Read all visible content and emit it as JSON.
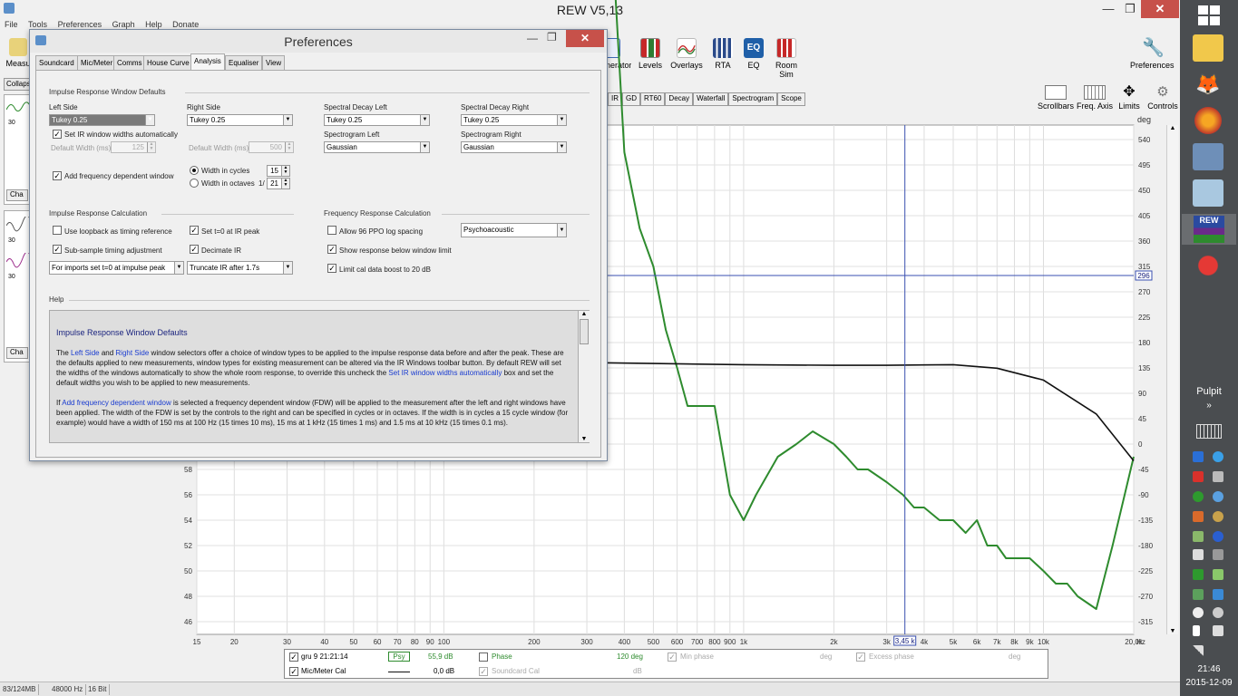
{
  "app": {
    "title": "REW V5,13",
    "minimize": "—",
    "maximize": "❐",
    "close": "✕"
  },
  "menu": [
    "File",
    "Tools",
    "Preferences",
    "Graph",
    "Help",
    "Donate"
  ],
  "toolbar_left": {
    "measure": "Measu",
    "collapse": "Collaps",
    "chart1": "Cha",
    "chart2": "Cha",
    "num30a": "30",
    "num30b": "30",
    "num30c": "30"
  },
  "toolbar": [
    {
      "label": "nerator",
      "icon": "generator-icon"
    },
    {
      "label": "Levels",
      "icon": "levels-icon"
    },
    {
      "label": "Overlays",
      "icon": "overlays-icon"
    },
    {
      "label": "RTA",
      "icon": "rta-icon"
    },
    {
      "label": "EQ",
      "icon": "eq-icon"
    },
    {
      "label": "Room Sim",
      "icon": "room-sim-icon"
    }
  ],
  "preferences_btn": "Preferences",
  "graph_tabs": [
    "IR",
    "GD",
    "RT60",
    "Decay",
    "Waterfall",
    "Spectrogram",
    "Scope"
  ],
  "graph_controls": [
    "Scrollbars",
    "Freq. Axis",
    "Limits",
    "Controls"
  ],
  "graph": {
    "right_axis_unit": "deg",
    "right_ticks": [
      "540",
      "495",
      "450",
      "405",
      "360",
      "315",
      "270",
      "225",
      "180",
      "135",
      "90",
      "45",
      "0",
      "-45",
      "-90",
      "-135",
      "-180",
      "-225",
      "-270",
      "-315"
    ],
    "left_ticks": [
      "58",
      "56",
      "54",
      "52",
      "50",
      "48",
      "46"
    ],
    "x_ticks": [
      "15",
      "20",
      "30",
      "40",
      "50",
      "60",
      "70",
      "80",
      "90",
      "100",
      "200",
      "300",
      "400",
      "500",
      "600",
      "700",
      "800",
      "900",
      "1k",
      "2k",
      "3k",
      "4k",
      "5k",
      "6k",
      "7k",
      "8k",
      "9k",
      "10k",
      "20,0k",
      "Hz"
    ],
    "cursor_x": "3,45 k",
    "cursor_y": "296",
    "colors": {
      "spl": "#2e8b2e",
      "phase": "#111111",
      "cursor": "#3a4fb0"
    }
  },
  "chart_data": {
    "type": "line",
    "xlabel": "Hz",
    "ylabel": "deg",
    "x_scale": "log",
    "xlim": [
      15,
      20000
    ],
    "ylim_right": [
      -315,
      540
    ],
    "series": [
      {
        "name": "gru 9 21:21:14",
        "x": [
          260,
          300,
          330,
          360,
          400,
          450,
          500,
          550,
          600,
          650,
          700,
          800,
          900,
          1000,
          1100,
          1300,
          1500,
          1700,
          2000,
          2200,
          2400,
          2600,
          3000,
          3400,
          3700,
          4000,
          4500,
          5000,
          5500,
          6000,
          6500,
          7000,
          7500,
          8000,
          8500,
          9000,
          10000,
          11000,
          12000,
          13000,
          15000,
          17000,
          20000
        ],
        "y": [
          154,
          134,
          119,
          102,
          83,
          77,
          74,
          69,
          66,
          63,
          63,
          63,
          56,
          54,
          56,
          59,
          60,
          61,
          60,
          59,
          58,
          58,
          57,
          56,
          55,
          55,
          54,
          54,
          53,
          54,
          52,
          52,
          51,
          51,
          51,
          51,
          50,
          49,
          49,
          48,
          47,
          52,
          59
        ]
      },
      {
        "name": "Mic/Meter Cal",
        "x": [
          260,
          500,
          1000,
          2000,
          3000,
          5000,
          7000,
          10000,
          15000,
          20000
        ],
        "y": [
          122,
          120,
          118,
          117,
          117,
          118,
          112,
          92,
          35,
          -44
        ]
      }
    ]
  },
  "legend": [
    {
      "checked": true,
      "name": "gru 9 21:21:14",
      "badge": "Psy",
      "value": "55,9 dB",
      "phase_label": "Phase",
      "phase_value": "120 deg",
      "minphase": "Min phase",
      "minphase_unit": "deg",
      "excess": "Excess phase",
      "excess_unit": "deg"
    },
    {
      "checked": true,
      "name": "Mic/Meter Cal",
      "value": "0,0 dB",
      "soundcard": "Soundcard Cal",
      "soundcard_unit": "dB"
    }
  ],
  "statusbar": {
    "memory": "83/124MB",
    "rate": "48000 Hz",
    "bits": "16 Bit"
  },
  "prefs": {
    "title": "Preferences",
    "tabs": [
      "Soundcard",
      "Mic/Meter",
      "Comms",
      "House Curve",
      "Analysis",
      "Equaliser",
      "View"
    ],
    "ir_window_title": "Impulse Response Window Defaults",
    "left_side": "Left Side",
    "left_side_value": "Tukey 0.25",
    "right_side": "Right Side",
    "right_side_value": "Tukey 0.25",
    "sd_left": "Spectral Decay Left",
    "sd_left_value": "Tukey 0.25",
    "sd_right": "Spectral Decay Right",
    "sd_right_value": "Tukey 0.25",
    "sg_left": "Spectrogram Left",
    "sg_left_value": "Gaussian",
    "sg_right": "Spectrogram Right",
    "sg_right_value": "Gaussian",
    "set_ir_auto": "Set IR window widths automatically",
    "default_width_ms": "Default Width (ms)",
    "default_width_left": "125",
    "default_width_right": "500",
    "add_fdw": "Add frequency dependent window",
    "width_cycles": "Width in cycles",
    "width_cycles_value": "15",
    "width_octaves": "Width in octaves",
    "octave_prefix": "1/",
    "width_octaves_value": "21",
    "ir_calc_title": "Impulse Response Calculation",
    "loopback": "Use loopback as timing reference",
    "set_t0": "Set t=0 at IR peak",
    "subsample": "Sub-sample timing adjustment",
    "decimate": "Decimate IR",
    "imports_value": "For imports set t=0 at impulse peak",
    "truncate_value": "Truncate IR after 1.7s",
    "fr_calc_title": "Frequency Response Calculation",
    "allow96": "Allow 96 PPO log spacing",
    "psycho_value": "Psychoacoustic",
    "show_below": "Show response below window limit",
    "limit_cal": "Limit cal data boost to 20 dB",
    "help_title": "Help",
    "help_heading": "Impulse Response Window Defaults",
    "help_p1_a": "The ",
    "help_p1_link1": "Left Side",
    "help_p1_b": " and ",
    "help_p1_link2": "Right Side",
    "help_p1_c": " window selectors offer a choice of window types to be applied to the impulse response data before and after the peak. These are the defaults applied to new measurements, window types for existing measurement can be altered via the IR Windows toolbar button. By default REW will set the widths of the windows automatically to show the whole room response, to override this uncheck the ",
    "help_p1_link3": "Set IR window widths automatically",
    "help_p1_d": " box and set the default widths you wish to be applied to new measurements.",
    "help_p2_a": "If ",
    "help_p2_link": "Add frequency dependent window",
    "help_p2_b": " is selected a frequency dependent window (FDW) will be applied to the measurement after the left and right windows have been applied. The width of the FDW is set by the controls to the right and can be specified in cycles or in octaves. If the width is in cycles a 15 cycle window (for example) would have a width of 150 ms at 100 Hz (15 times 10 ms), 15 ms at 1 kHz (15 times 1 ms) and 1.5 ms at 10 kHz (15 times 0.1 ms)."
  },
  "taskbar": {
    "pulpit": "Pulpit",
    "time": "21:46",
    "date": "2015-12-09",
    "chevron": "»"
  }
}
